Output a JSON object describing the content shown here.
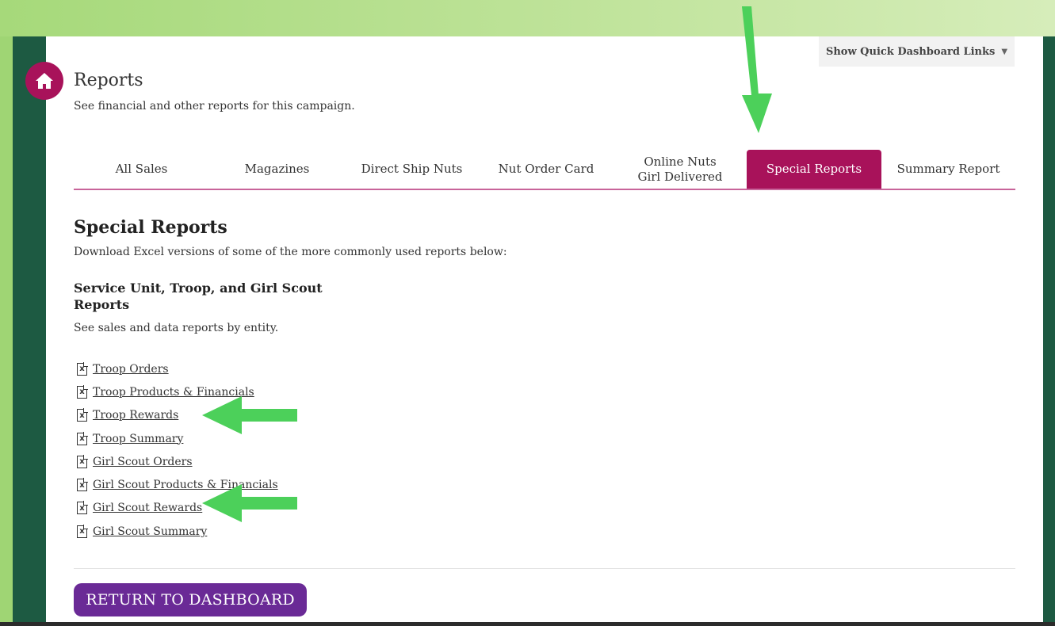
{
  "header": {
    "quick_links_label": "Show Quick Dashboard Links",
    "caret": "▼",
    "title": "Reports",
    "subtitle": "See financial and other reports for this campaign."
  },
  "tabs": [
    {
      "label": "All Sales",
      "active": false
    },
    {
      "label": "Magazines",
      "active": false
    },
    {
      "label": "Direct Ship Nuts",
      "active": false
    },
    {
      "label": "Nut Order Card",
      "active": false
    },
    {
      "label": "Online Nuts Girl Delivered",
      "active": false
    },
    {
      "label": "Special Reports",
      "active": true
    },
    {
      "label": "Summary Report",
      "active": false
    }
  ],
  "section": {
    "title": "Special Reports",
    "description": "Download Excel versions of some of the more commonly used reports below:"
  },
  "group": {
    "title": "Service Unit, Troop, and Girl Scout Reports",
    "description": "See sales and data reports by entity."
  },
  "reports": [
    {
      "label": "Troop Orders",
      "icon": "excel-file-icon"
    },
    {
      "label": "Troop Products & Financials",
      "icon": "excel-file-icon"
    },
    {
      "label": "Troop Rewards",
      "icon": "excel-file-icon"
    },
    {
      "label": "Troop Summary",
      "icon": "excel-file-icon"
    },
    {
      "label": "Girl Scout Orders",
      "icon": "excel-file-icon"
    },
    {
      "label": "Girl Scout Products & Financials",
      "icon": "excel-file-icon"
    },
    {
      "label": "Girl Scout Rewards",
      "icon": "excel-file-icon"
    },
    {
      "label": "Girl Scout Summary",
      "icon": "excel-file-icon"
    }
  ],
  "footer": {
    "return_label": "RETURN TO DASHBOARD"
  },
  "colors": {
    "brand_magenta": "#a8125a",
    "button_purple": "#6a2a96",
    "annotation_green": "#4cd05a"
  },
  "icons": {
    "home": "home-icon",
    "report": "excel-file-icon"
  }
}
